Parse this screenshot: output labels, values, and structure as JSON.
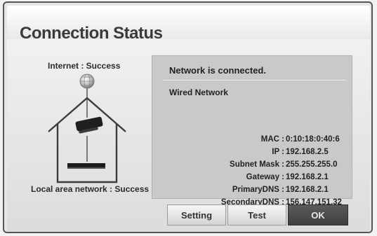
{
  "window": {
    "title": "Connection Status"
  },
  "status": {
    "internet": "Internet : Success",
    "local": "Local area network : Success"
  },
  "info": {
    "connected_text": "Network is connected.",
    "connection_type": "Wired Network",
    "rows": [
      {
        "label": "MAC",
        "value": "0:10:18:0:40:6"
      },
      {
        "label": "IP",
        "value": "192.168.2.5"
      },
      {
        "label": "Subnet Mask",
        "value": "255.255.255.0"
      },
      {
        "label": "Gateway",
        "value": "192.168.2.1"
      },
      {
        "label": "PrimaryDNS",
        "value": "192.168.2.1"
      },
      {
        "label": "SecondaryDNS",
        "value": "156.147.151.32"
      }
    ]
  },
  "buttons": {
    "setting": "Setting",
    "test": "Test",
    "ok": "OK"
  }
}
